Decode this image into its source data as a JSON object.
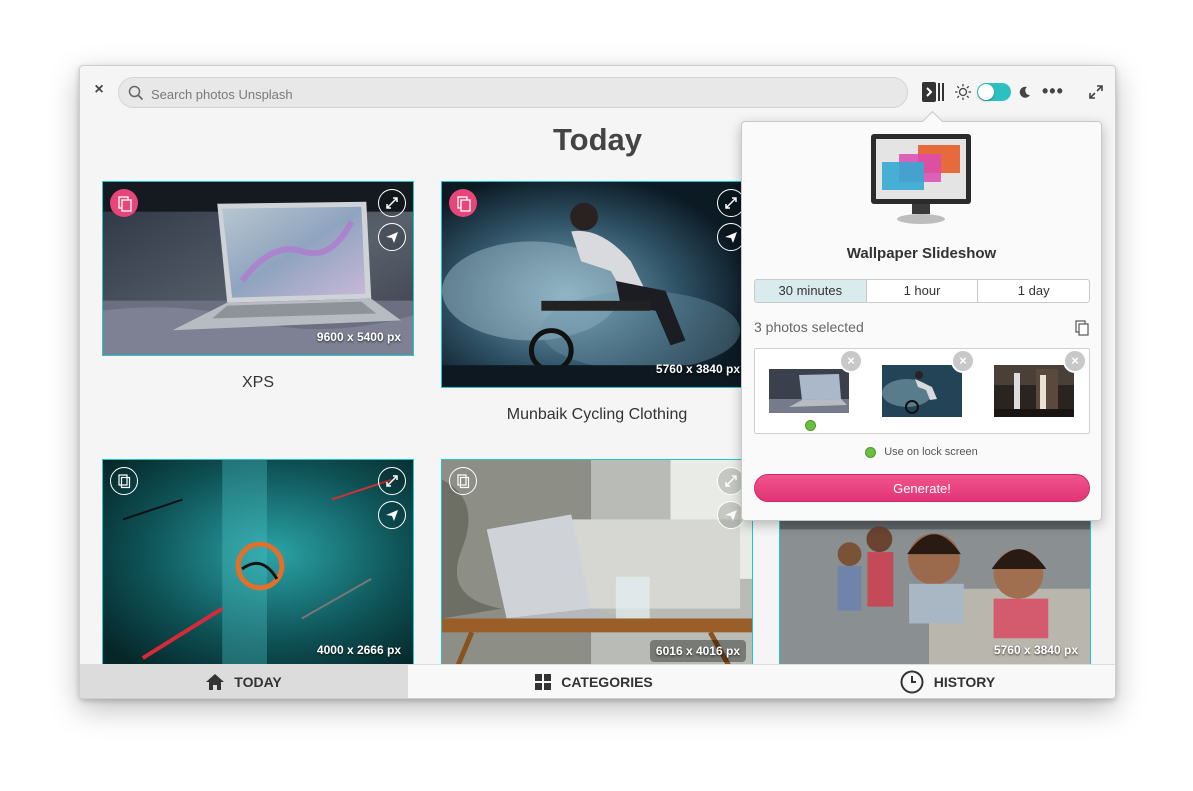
{
  "header": {
    "search_placeholder": "Search photos Unsplash"
  },
  "main": {
    "title": "Today",
    "photos": [
      {
        "title": "XPS",
        "size": "9600 x 5400  px"
      },
      {
        "title": "Munbaik Cycling Clothing",
        "size": "5760 x 3840  px"
      },
      {
        "title": "",
        "size": "4000 x 2666  px"
      },
      {
        "title": "",
        "size": "6016 x 4016  px"
      },
      {
        "title": "",
        "size": "5760 x 3840  px"
      }
    ]
  },
  "slideshow": {
    "title": "Wallpaper Slideshow",
    "intervals": [
      "30 minutes",
      "1 hour",
      "1 day"
    ],
    "selected_interval": "30 minutes",
    "selected_count": "3 photos selected",
    "remove_glyph": "×",
    "lock_screen_label": "Use on lock screen",
    "generate_label": "Generate!"
  },
  "tabs": [
    {
      "label": "TODAY",
      "icon": "home-icon",
      "active": true
    },
    {
      "label": "CATEGORIES",
      "icon": "grid-icon",
      "active": false
    },
    {
      "label": "HISTORY",
      "icon": "clock-icon",
      "active": false
    }
  ],
  "colors": {
    "accent": "#1ec8c8",
    "pink": "#e8457a",
    "toggle": "#2cc0c0"
  }
}
